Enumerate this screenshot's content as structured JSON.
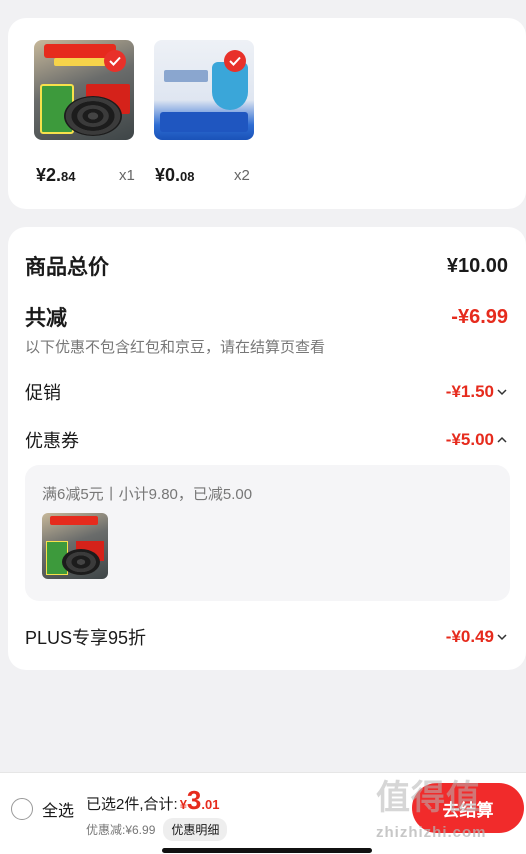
{
  "products": [
    {
      "price_int": "¥2.",
      "price_dec": "84",
      "qty": "x1"
    },
    {
      "price_int": "¥0.",
      "price_dec": "08",
      "qty": "x2"
    }
  ],
  "summary": {
    "total_label": "商品总价",
    "total_value": "¥10.00",
    "discount_label": "共减",
    "discount_value": "-¥6.99",
    "hint": "以下优惠不包含红包和京豆，请在结算页查看",
    "promo_label": "促销",
    "promo_value": "-¥1.50",
    "coupon_label": "优惠券",
    "coupon_value": "-¥5.00",
    "coupon_desc": "满6减5元丨小计9.80，已减5.00",
    "plus_label": "PLUS专享95折",
    "plus_value": "-¥0.49"
  },
  "bottom_bar": {
    "select_all_label": "全选",
    "selected_prefix": "已选2件,合计:",
    "currency": "¥",
    "total_int": "3",
    "total_dec": ".01",
    "discount_text": "优惠减:¥6.99",
    "detail_label": "优惠明细",
    "checkout_label": "去结算"
  },
  "watermark": {
    "text": "值得值",
    "url": "zhizhizhi.com"
  },
  "colors": {
    "accent": "#e62b1d",
    "button": "#f12b2b"
  }
}
